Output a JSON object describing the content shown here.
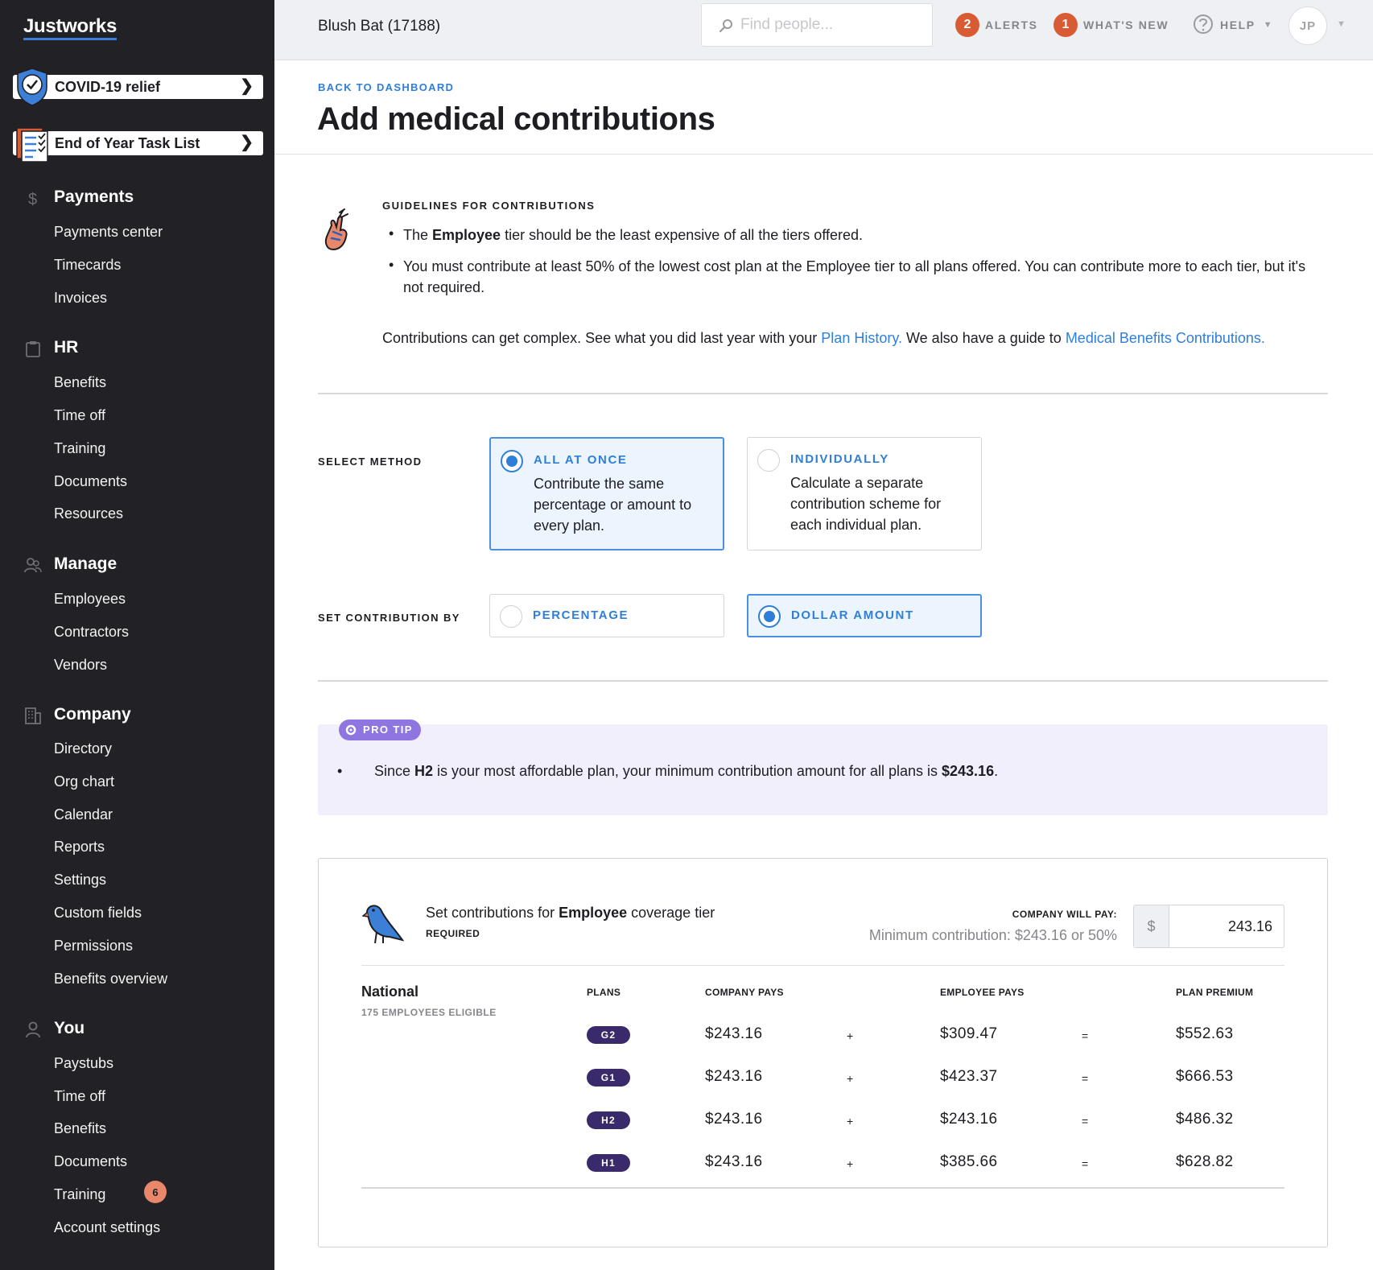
{
  "sidebar": {
    "logo": "Justworks",
    "promos": [
      {
        "label": "COVID-19 relief"
      },
      {
        "label": "End of Year Task List"
      }
    ],
    "sections": [
      {
        "title": "Payments",
        "items": [
          "Payments center",
          "Timecards",
          "Invoices"
        ]
      },
      {
        "title": "HR",
        "items": [
          "Benefits",
          "Time off",
          "Training",
          "Documents",
          "Resources"
        ]
      },
      {
        "title": "Manage",
        "items": [
          "Employees",
          "Contractors",
          "Vendors"
        ]
      },
      {
        "title": "Company",
        "items": [
          "Directory",
          "Org chart",
          "Calendar",
          "Reports",
          "Settings",
          "Custom fields",
          "Permissions",
          "Benefits overview"
        ]
      },
      {
        "title": "You",
        "items": [
          "Paystubs",
          "Time off",
          "Benefits",
          "Documents",
          "Training",
          "Account settings"
        ]
      }
    ],
    "training_badge": "6"
  },
  "topbar": {
    "company": "Blush Bat (17188)",
    "search_placeholder": "Find people...",
    "alerts_count": "2",
    "alerts_label": "ALERTS",
    "whats_new_count": "1",
    "whats_new_label": "WHAT'S NEW",
    "help_label": "HELP",
    "avatar_initials": "JP"
  },
  "header": {
    "back_link": "BACK TO DASHBOARD",
    "title": "Add medical contributions"
  },
  "guidelines": {
    "title": "GUIDELINES FOR CONTRIBUTIONS",
    "bullet1_pre": "The ",
    "bullet1_bold": "Employee",
    "bullet1_post": " tier should be the least expensive of all the tiers offered.",
    "bullet2": "You must contribute at least 50% of the lowest cost plan at the Employee tier to all plans offered. You can contribute more to each tier, but it's not required.",
    "more_pre": "Contributions can get complex. See what you did last year with your ",
    "link_plan_history": "Plan History.",
    "more_mid": " We also have a guide to ",
    "link_guide": "Medical Benefits Contributions."
  },
  "method": {
    "label": "SELECT METHOD",
    "options": [
      {
        "title": "ALL AT ONCE",
        "desc": "Contribute the same percentage or amount to every plan.",
        "selected": true
      },
      {
        "title": "INDIVIDUALLY",
        "desc": "Calculate a separate contribution scheme for each individual plan.",
        "selected": false
      }
    ]
  },
  "contribution_by": {
    "label": "SET CONTRIBUTION BY",
    "options": [
      {
        "title": "PERCENTAGE",
        "selected": false
      },
      {
        "title": "DOLLAR AMOUNT",
        "selected": true
      }
    ]
  },
  "protip": {
    "badge": "PRO TIP",
    "text_pre": "Since ",
    "plan": "H2",
    "text_mid": " is your most affordable plan, your minimum contribution amount for all plans is ",
    "amount": "$243.16",
    "text_end": "."
  },
  "contributions": {
    "title_pre": "Set contributions for ",
    "title_bold": "Employee",
    "title_post": " coverage tier",
    "required": "REQUIRED",
    "company_will_pay_label": "COMPANY WILL PAY:",
    "min_contribution": "Minimum contribution: $243.16 or 50%",
    "currency": "$",
    "amount_value": "243.16",
    "group": {
      "name": "National",
      "eligible": "175 EMPLOYEES ELIGIBLE"
    },
    "columns": [
      "PLANS",
      "COMPANY PAYS",
      "EMPLOYEE PAYS",
      "PLAN PREMIUM"
    ],
    "plus": "+",
    "equals": "=",
    "rows": [
      {
        "plan": "G2",
        "company": "$243.16",
        "employee": "$309.47",
        "premium": "$552.63"
      },
      {
        "plan": "G1",
        "company": "$243.16",
        "employee": "$423.37",
        "premium": "$666.53"
      },
      {
        "plan": "H2",
        "company": "$243.16",
        "employee": "$243.16",
        "premium": "$486.32"
      },
      {
        "plan": "H1",
        "company": "$243.16",
        "employee": "$385.66",
        "premium": "$628.82"
      }
    ]
  },
  "colors": {
    "sidebar_bg": "#222226",
    "accent_blue": "#2f7fd8",
    "badge_orange": "#d95b34",
    "protip_bg": "#f1effb",
    "plan_pill": "#3a2a6b"
  }
}
